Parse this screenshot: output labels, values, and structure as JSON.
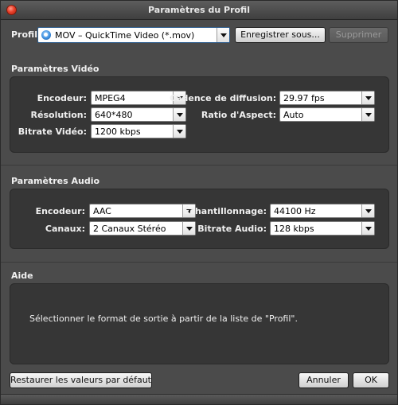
{
  "window": {
    "title": "Paramètres du Profil"
  },
  "profile": {
    "label": "Profil:",
    "selected": "MOV – QuickTime Video (*.mov)",
    "save_label": "Enregistrer sous...",
    "delete_label": "Supprimer"
  },
  "video": {
    "section_title": "Paramètres Vidéo",
    "encoder_label": "Encodeur:",
    "encoder_value": "MPEG4",
    "resolution_label": "Résolution:",
    "resolution_value": "640*480",
    "bitrate_label": "Bitrate Vidéo:",
    "bitrate_value": "1200 kbps",
    "framerate_label": "Cadence de diffusion:",
    "framerate_value": "29.97 fps",
    "aspect_label": "Ratio d'Aspect:",
    "aspect_value": "Auto"
  },
  "audio": {
    "section_title": "Paramètres Audio",
    "encoder_label": "Encodeur:",
    "encoder_value": "AAC",
    "channels_label": "Canaux:",
    "channels_value": "2 Canaux Stéréo",
    "samplerate_label": "Échantillonnage:",
    "samplerate_value": "44100 Hz",
    "bitrate_label": "Bitrate Audio:",
    "bitrate_value": "128 kbps"
  },
  "help": {
    "section_title": "Aide",
    "text": "Sélectionner le format de sortie à partir de la liste de \"Profil\"."
  },
  "footer": {
    "restore_label": "Restaurer les valeurs par défaut",
    "cancel_label": "Annuler",
    "ok_label": "OK"
  }
}
